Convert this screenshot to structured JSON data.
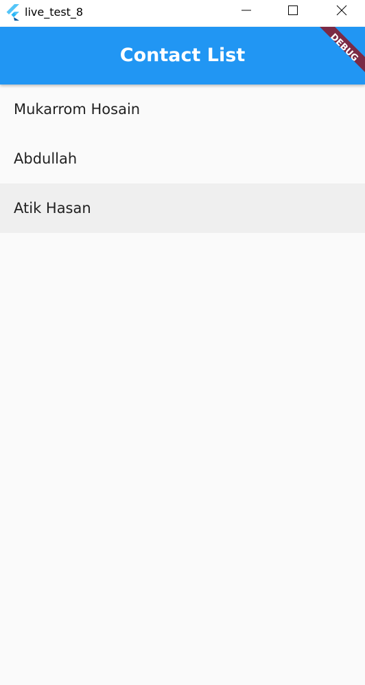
{
  "window": {
    "title": "live_test_8",
    "icon": "flutter-logo-icon",
    "controls": [
      "minimize-icon",
      "maximize-icon",
      "close-icon"
    ]
  },
  "appbar": {
    "title": "Contact List",
    "color": "#2196f3",
    "debug_banner": "DEBUG",
    "debug_banner_color": "#7b2a45"
  },
  "contacts": [
    {
      "name": "Mukarrom Hosain",
      "highlighted": false
    },
    {
      "name": "Abdullah",
      "highlighted": false
    },
    {
      "name": "Atik Hasan",
      "highlighted": true
    }
  ],
  "colors": {
    "background": "#fafafa",
    "highlight": "#efefef",
    "text": "#212121"
  }
}
